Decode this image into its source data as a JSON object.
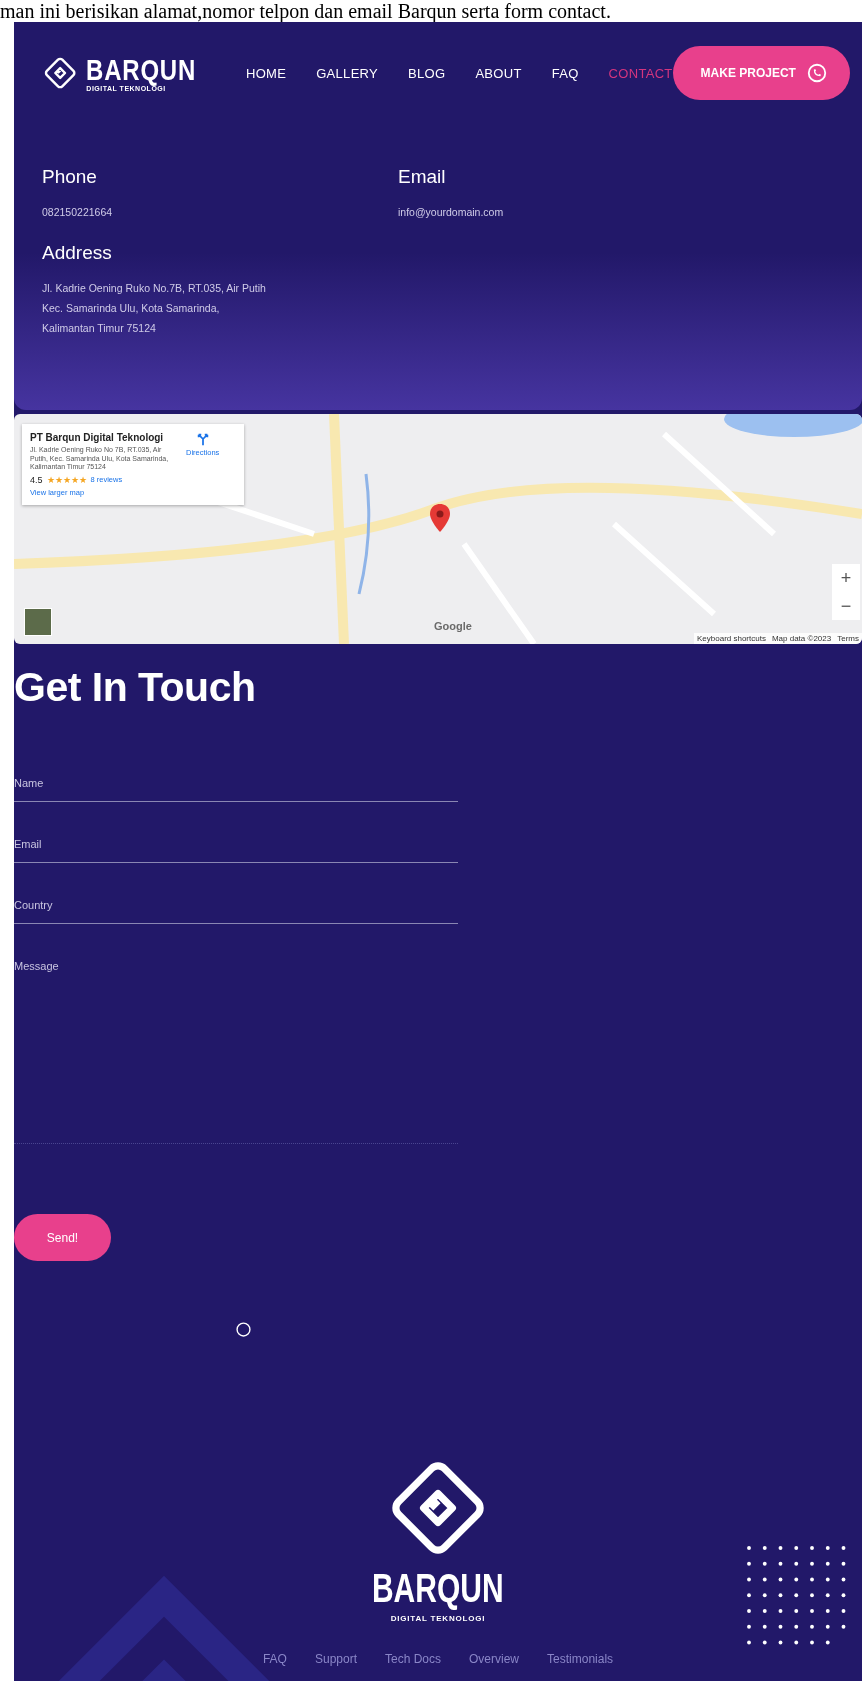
{
  "caption": "man ini berisikan alamat,nomor telpon dan email Barqun serta form contact.",
  "header": {
    "brand": "BARQUN",
    "tagline": "DIGITAL TEKNOLOGI",
    "nav": [
      {
        "label": "HOME",
        "selected": false
      },
      {
        "label": "GALLERY",
        "selected": false
      },
      {
        "label": "BLOG",
        "selected": false
      },
      {
        "label": "ABOUT",
        "selected": false
      },
      {
        "label": "FAQ",
        "selected": false
      },
      {
        "label": "CONTACT",
        "selected": true
      }
    ],
    "cta": "MAKE PROJECT"
  },
  "contact": {
    "phone": {
      "label": "Phone",
      "value": "082150221664"
    },
    "email": {
      "label": "Email",
      "value": "info@yourdomain.com"
    },
    "address": {
      "label": "Address",
      "lines": [
        "Jl. Kadrie Oening Ruko No.7B, RT.035, Air Putih",
        "Kec. Samarinda Ulu, Kota Samarinda,",
        "Kalimantan Timur 75124"
      ]
    }
  },
  "map": {
    "place": {
      "name": "PT Barqun Digital Teknologi",
      "address": "Jl. Kadrie Oening Ruko No 7B, RT.035, Air Putih, Kec. Samarinda Ulu, Kota Samarinda, Kalimantan Timur 75124",
      "rating": "4.5",
      "stars": 5,
      "reviews": "8 reviews",
      "directions": "Directions",
      "larger_map": "View larger map"
    },
    "zoom_in": "+",
    "zoom_out": "−",
    "google": "Google",
    "attribution": [
      "Keyboard shortcuts",
      "Map data ©2023",
      "Terms"
    ]
  },
  "form": {
    "title": "Get In Touch",
    "fields": [
      {
        "kind": "line",
        "placeholder": "Name"
      },
      {
        "kind": "line",
        "placeholder": "Email"
      },
      {
        "kind": "line",
        "placeholder": "Country"
      },
      {
        "kind": "area",
        "placeholder": "Message"
      }
    ],
    "submit": "Send!"
  },
  "footer": {
    "brand": "BARQUN",
    "tagline": "DIGITAL TEKNOLOGI",
    "links": [
      "FAQ",
      "Support",
      "Tech Docs",
      "Overview",
      "Testimonials"
    ]
  }
}
